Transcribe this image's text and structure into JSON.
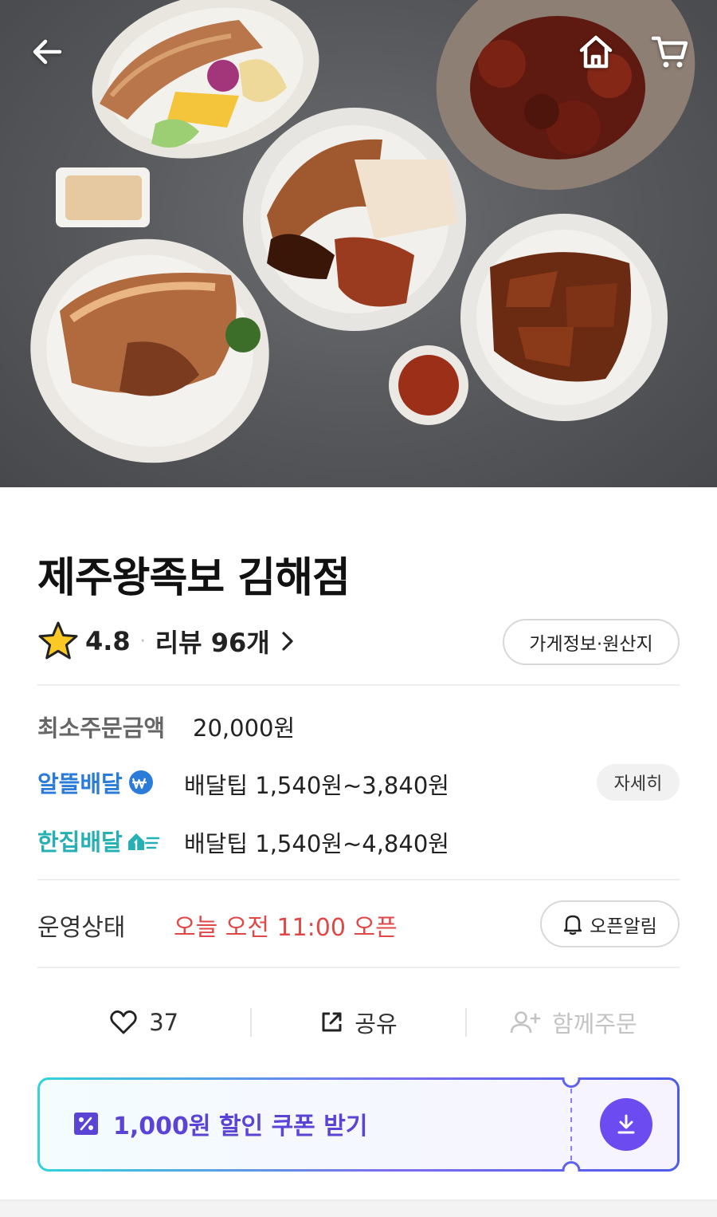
{
  "hero": {
    "back_icon": "arrow-left-icon",
    "home_icon": "home-icon",
    "cart_icon": "cart-icon"
  },
  "store": {
    "name": "제주왕족보 김해점",
    "rating": "4.8",
    "rating_separator": "·",
    "review_link": "리뷰 96개",
    "info_button": "가게정보·원산지"
  },
  "order_info": {
    "min_order_label": "최소주문금액",
    "min_order_value": "20,000원",
    "altteul_label": "알뜰배달",
    "altteul_tip": "배달팁 1,540원~3,840원",
    "detail_button": "자세히",
    "hanjip_label": "한집배달",
    "hanjip_tip": "배달팁 1,540원~4,840원"
  },
  "status": {
    "label": "운영상태",
    "value": "오늘 오전 11:00 오픈",
    "notify_button": "오픈알림"
  },
  "actions": {
    "like_count": "37",
    "share_label": "공유",
    "group_order_label": "함께주문"
  },
  "coupon": {
    "label": "1,000원 할인 쿠폰 받기"
  },
  "colors": {
    "accent_purple": "#6c4bf0",
    "status_red": "#e04848",
    "altteul_blue": "#2b7bd9",
    "hanjip_teal": "#26b0b3"
  }
}
